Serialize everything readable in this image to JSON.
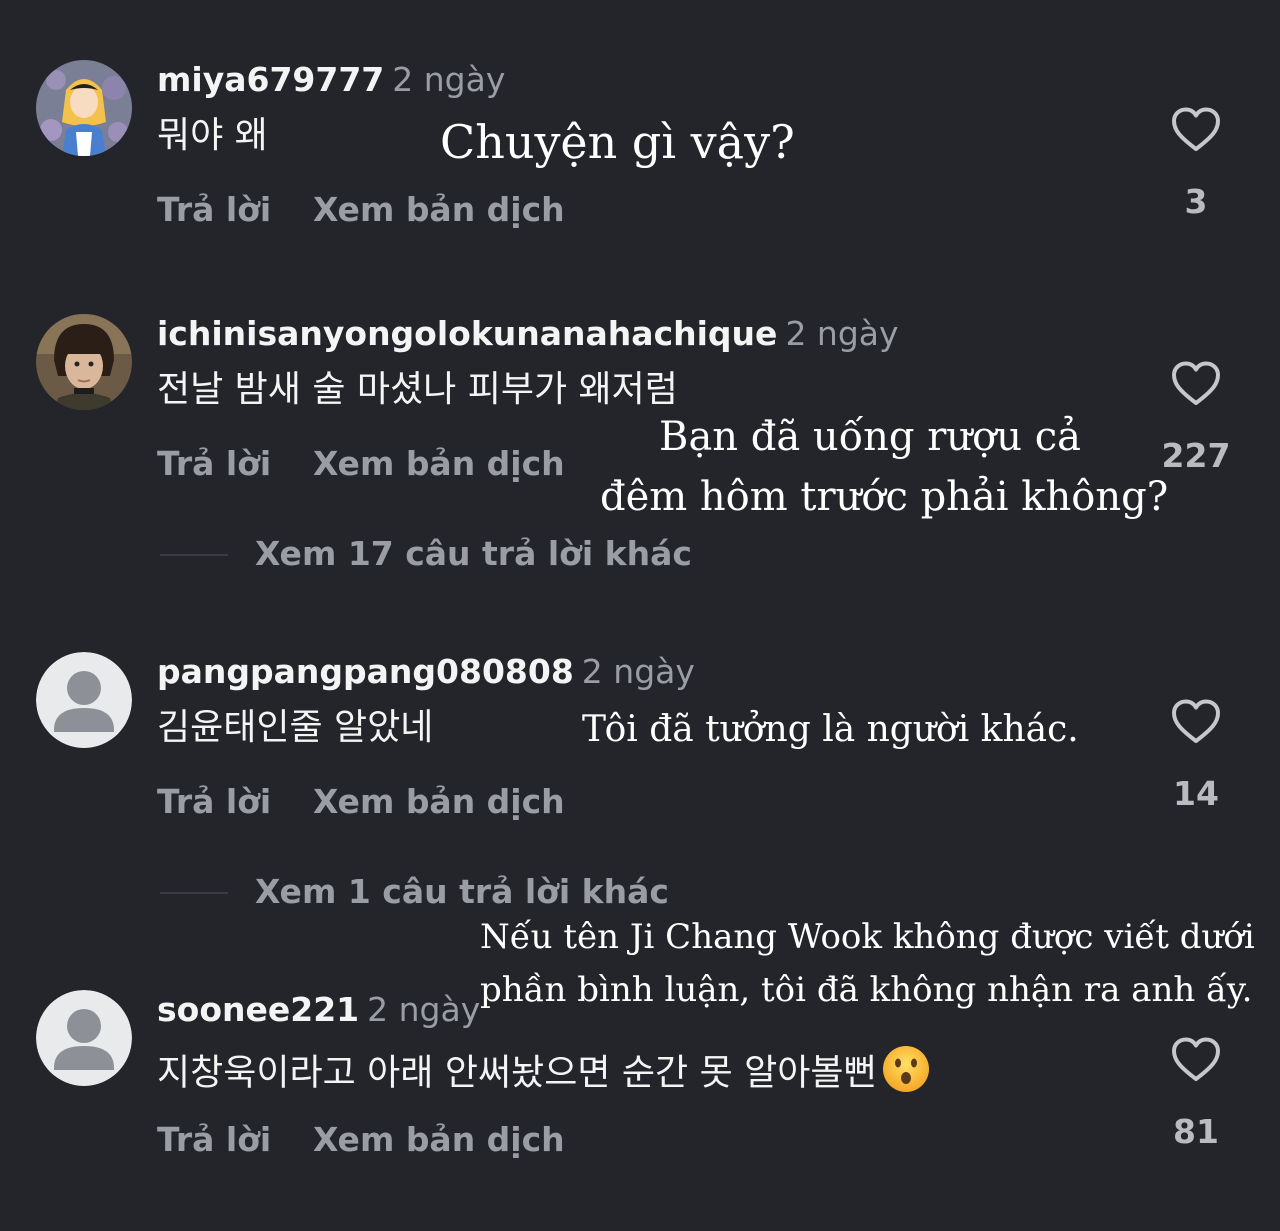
{
  "comments": [
    {
      "username": "miya679777",
      "time": "2 ngày",
      "text": "뭐야 왜",
      "reply_label": "Trả lời",
      "translate_label": "Xem bản dịch",
      "likes": "3",
      "avatar": "alice-cartoon-avatar"
    },
    {
      "username": "ichinisanyongolokunanahachique",
      "time": "2 ngày",
      "text": "전날 밤새 술 마셨나 피부가 왜저럼",
      "reply_label": "Trả lời",
      "translate_label": "Xem bản dịch",
      "likes": "227",
      "more_replies": "Xem 17 câu trả lời khác",
      "avatar": "girl-photo-avatar"
    },
    {
      "username": "pangpangpang080808",
      "time": "2 ngày",
      "text": "김윤태인줄 알았네",
      "reply_label": "Trả lời",
      "translate_label": "Xem bản dịch",
      "likes": "14",
      "more_replies": "Xem 1 câu trả lời khác",
      "avatar": "default-user-avatar"
    },
    {
      "username": "soonee221",
      "time": "2 ngày",
      "text": "지창욱이라고 아래 안써놨으면 순간 못 알아볼뻔",
      "emoji": "hushed-face-emoji",
      "reply_label": "Trả lời",
      "translate_label": "Xem bản dịch",
      "likes": "81",
      "avatar": "default-user-avatar"
    }
  ],
  "overlays": {
    "translation_1": "Chuyện gì vậy?",
    "translation_2_line1": "Bạn đã uống rượu cả",
    "translation_2_line2": "đêm hôm trước phải không?",
    "translation_3": "Tôi đã tưởng là người khác.",
    "translation_4_line1": "Nếu tên Ji Chang Wook không được viết dưới",
    "translation_4_line2": "phần bình luận, tôi đã không nhận ra anh ấy."
  },
  "colors": {
    "background": "#23252b",
    "secondary_text": "#9a9da4",
    "primary_text": "#f4f4f4"
  }
}
